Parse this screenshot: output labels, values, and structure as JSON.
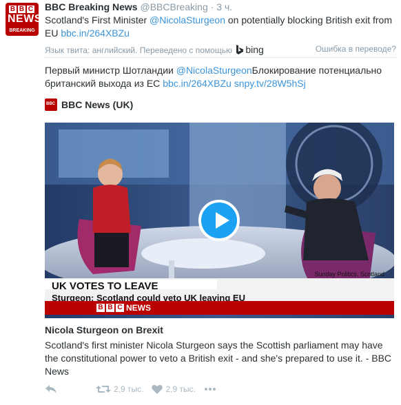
{
  "avatar": {
    "logo_letters": [
      "B",
      "B",
      "C"
    ],
    "logo_news": "NEWS",
    "logo_breaking": "BREAKING",
    "brand_color": "#b80000"
  },
  "header": {
    "name": "BBC Breaking News",
    "handle": "@BBCBreaking",
    "dot": "·",
    "time": "3 ч."
  },
  "tweet": {
    "text_before": "Scotland's First Minister ",
    "mention": "@NicolaSturgeon",
    "text_after": " on potentially blocking British exit from EU ",
    "link": "bbc.in/264XBZu"
  },
  "translation": {
    "label": "Язык твита: английский. Переведено с помощью",
    "provider": "bing",
    "error": "Ошибка в переводе?",
    "text_before": "Первый министр Шотландии ",
    "mention": "@NicolaSturgeon",
    "text_middle": "Блокирование потенциально британский выхода из ЕС ",
    "link1": "bbc.in/264XBZu",
    "link2": "snpy.tv/28W5hSj"
  },
  "card": {
    "source": "BBC News (UK)",
    "mini_logo_text": "BBC",
    "video": {
      "lower_third_1": "UK VOTES TO LEAVE",
      "lower_third_2": "Sturgeon: Scotland could veto UK leaving EU",
      "caption": "Sunday Politics, Scotland",
      "bar_letters": [
        "B",
        "B",
        "C"
      ],
      "bar_news": "NEWS"
    },
    "title": "Nicola Sturgeon on Brexit",
    "description": "Scotland's first minister Nicola Sturgeon says the Scottish parliament may have the constitutional power to veto a British exit - and she's prepared to use it. - BBC News"
  },
  "actions": {
    "reply_icon": "reply-icon",
    "retweet_count": "2,9 тыс.",
    "like_count": "2,9 тыс.",
    "more_icon": "more-icon"
  },
  "colors": {
    "link": "#3b94d9",
    "muted": "#8899a6",
    "text": "#292f33"
  }
}
